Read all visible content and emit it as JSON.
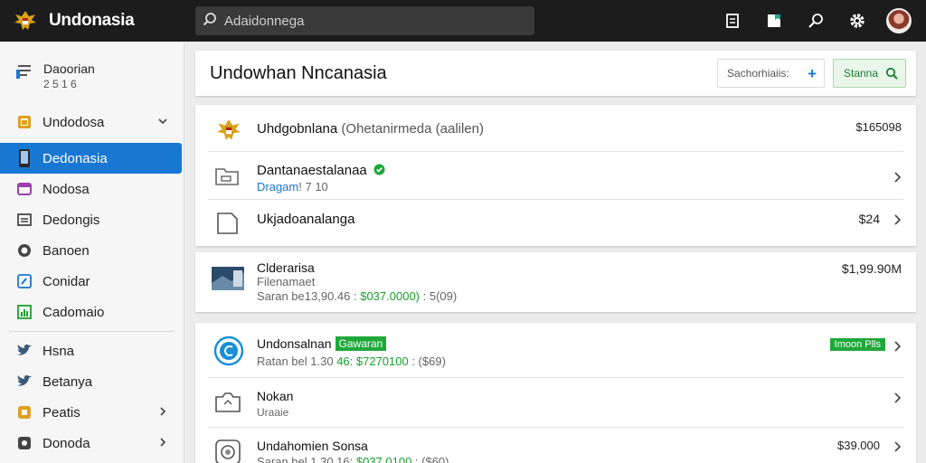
{
  "app": {
    "title": "Undonasia",
    "search_placeholder": "Adaidonnega"
  },
  "top_icons": [
    "receipt-icon",
    "bookmark-icon",
    "search-icon",
    "gear-icon",
    "avatar"
  ],
  "sidebar": {
    "profile": {
      "name": "Daoorian",
      "sub": "2 5 1 6"
    },
    "items": [
      {
        "label": "Undodosa",
        "icon": "folder-icon",
        "color": "#e0a020",
        "chevron": "down"
      },
      {
        "label": "Dedonasia",
        "icon": "phone-icon",
        "color": "#1877d3",
        "active": true
      },
      {
        "label": "Nodosa",
        "icon": "inbox-icon",
        "color": "#a03db0"
      },
      {
        "label": "Dedongis",
        "icon": "list-icon",
        "color": "#333333"
      },
      {
        "label": "Banoen",
        "icon": "clock-icon",
        "color": "#333333"
      },
      {
        "label": "Conidar",
        "icon": "edit-icon",
        "color": "#1877d3"
      },
      {
        "label": "Cadomaio",
        "icon": "chart-icon",
        "color": "#18a02a"
      }
    ],
    "items2": [
      {
        "label": "Hsna",
        "icon": "twitter-icon",
        "color": "#3a5a78"
      },
      {
        "label": "Betanya",
        "icon": "twitter-icon",
        "color": "#3a5a78"
      },
      {
        "label": "Peatis",
        "icon": "flag-icon",
        "color": "#e0a020",
        "chevron": "right"
      },
      {
        "label": "Donoda",
        "icon": "lock-icon",
        "color": "#444444",
        "chevron": "right"
      }
    ]
  },
  "header": {
    "title": "Undowhan Nncanasia",
    "field_text": "Sachorhiaiis:",
    "button_label": "Stanna"
  },
  "card1": {
    "rows": [
      {
        "title": "Uhdgobnlana",
        "title_extra": " (Ohetanirmeda (aalilen)",
        "value": "$165098",
        "icon": "emblem"
      },
      {
        "title": "Dantanaestalanaa",
        "sub": "Dragam",
        "sub_extra": "! 7 10",
        "icon": "receipt-icon",
        "verified": true
      },
      {
        "title": "Ukjadoanalanga",
        "value": "$24",
        "icon": "document-icon"
      }
    ]
  },
  "card2": {
    "rows": [
      {
        "title": "Clderarisa",
        "sub1": "Filenamaet",
        "sub2_a": "Saran be13,90.46 :",
        "sub2_b": "$037.0000)",
        "sub2_c": " : 5(09)",
        "value": "$1,99.90M",
        "icon": "thumbnail"
      }
    ]
  },
  "card3": {
    "rows": [
      {
        "title": "Undonsalnan",
        "tag": "Gawaran",
        "sub_a": "Ratan bel 1.30 ",
        "sub_b": "46: $7270100",
        "sub_c": " : ($69)",
        "badge": "Imoon Plls",
        "icon": "circle-c-icon"
      },
      {
        "title": "Nokan",
        "sub": "Uraaie",
        "icon": "camera-icon"
      },
      {
        "title": "Undahomien Sonsa",
        "sub_a": "Saran bel 1.30.16: ",
        "sub_b": "$037.0100",
        "sub_c": " : ($60)",
        "value": "$39.000",
        "icon": "disc-icon"
      }
    ]
  }
}
